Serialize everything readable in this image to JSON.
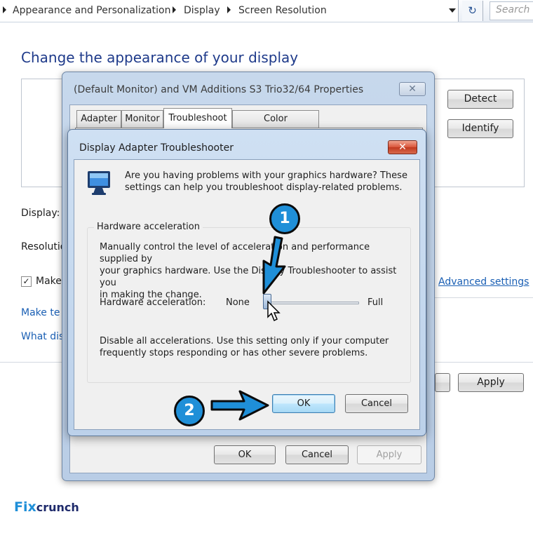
{
  "address_bar": {
    "breadcrumbs": [
      "Appearance and Personalization",
      "Display",
      "Screen Resolution"
    ],
    "search_placeholder": "Search C"
  },
  "control_panel": {
    "heading": "Change the appearance of your display",
    "detect_label": "Detect",
    "identify_label": "Identify",
    "display_label": "Display:",
    "resolution_label": "Resolutio",
    "make_checkbox_label": "Make",
    "advanced_settings_link": "Advanced settings",
    "link_make_text": "Make te",
    "link_what_display": "What dis",
    "apply_label": "Apply"
  },
  "properties_dialog": {
    "title": "(Default Monitor) and VM Additions S3 Trio32/64 Properties",
    "close_label": "✕",
    "tabs": [
      "Adapter",
      "Monitor",
      "Troubleshoot",
      "Color Management"
    ],
    "active_tab": "Troubleshoot",
    "ok_label": "OK",
    "cancel_label": "Cancel",
    "apply_label": "Apply"
  },
  "troubleshooter": {
    "title": "Display Adapter Troubleshooter",
    "close_label": "✕",
    "intro_line1": "Are you having problems with your graphics hardware? These",
    "intro_line2": "settings can help you troubleshoot display-related problems.",
    "group_label": "Hardware acceleration",
    "desc_line1": "Manually control the level of acceleration and performance supplied by",
    "desc_line2": "your graphics hardware. Use the Display Troubleshooter to assist you",
    "desc_line3": "in making the change.",
    "slider_label": "Hardware acceleration:",
    "slider_min_label": "None",
    "slider_max_label": "Full",
    "slider_value_fraction": 0.0,
    "note_line1": "Disable all accelerations. Use this setting only if your computer",
    "note_line2": "frequently stops responding or has other severe problems.",
    "ok_label": "OK",
    "cancel_label": "Cancel"
  },
  "annotations": {
    "step1": "1",
    "step2": "2",
    "accent_color": "#1f8fd8"
  },
  "watermark": {
    "brand_part1": "Fix",
    "brand_part2": "crunch"
  }
}
